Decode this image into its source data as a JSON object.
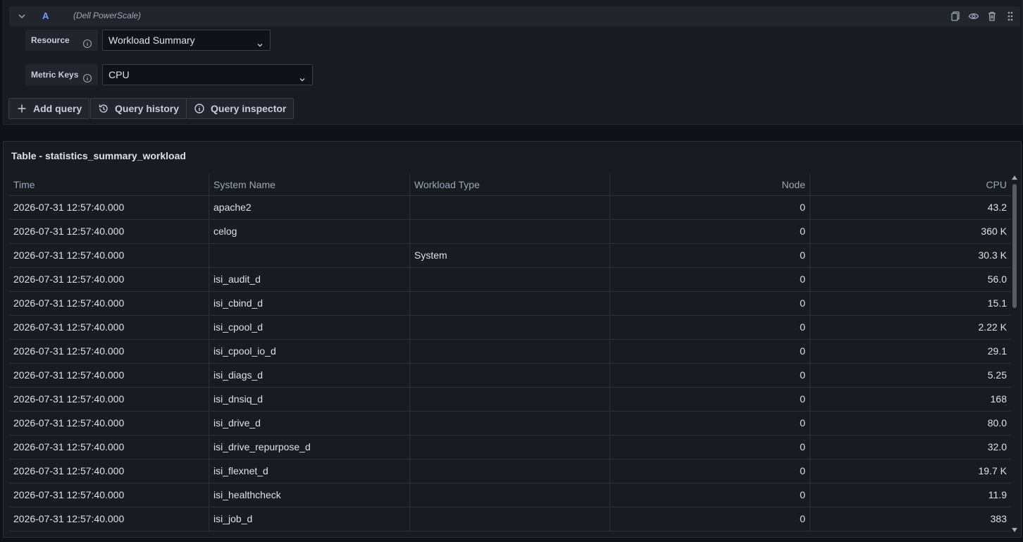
{
  "query": {
    "ref_id": "A",
    "datasource": "(Dell PowerScale)",
    "resource_label": "Resource",
    "resource_value": "Workload Summary",
    "metric_keys_label": "Metric Keys",
    "metric_keys_value": "CPU"
  },
  "buttons": {
    "add_query": "Add query",
    "query_history": "Query history",
    "query_inspector": "Query inspector"
  },
  "panel": {
    "title": "Table - statistics_summary_workload"
  },
  "table": {
    "columns": [
      "Time",
      "System Name",
      "Workload Type",
      "Node",
      "CPU"
    ],
    "rows": [
      [
        "2026-07-31 12:57:40.000",
        "apache2",
        "",
        "0",
        "43.2"
      ],
      [
        "2026-07-31 12:57:40.000",
        "celog",
        "",
        "0",
        "360 K"
      ],
      [
        "2026-07-31 12:57:40.000",
        "",
        "System",
        "0",
        "30.3 K"
      ],
      [
        "2026-07-31 12:57:40.000",
        "isi_audit_d",
        "",
        "0",
        "56.0"
      ],
      [
        "2026-07-31 12:57:40.000",
        "isi_cbind_d",
        "",
        "0",
        "15.1"
      ],
      [
        "2026-07-31 12:57:40.000",
        "isi_cpool_d",
        "",
        "0",
        "2.22 K"
      ],
      [
        "2026-07-31 12:57:40.000",
        "isi_cpool_io_d",
        "",
        "0",
        "29.1"
      ],
      [
        "2026-07-31 12:57:40.000",
        "isi_diags_d",
        "",
        "0",
        "5.25"
      ],
      [
        "2026-07-31 12:57:40.000",
        "isi_dnsiq_d",
        "",
        "0",
        "168"
      ],
      [
        "2026-07-31 12:57:40.000",
        "isi_drive_d",
        "",
        "0",
        "80.0"
      ],
      [
        "2026-07-31 12:57:40.000",
        "isi_drive_repurpose_d",
        "",
        "0",
        "32.0"
      ],
      [
        "2026-07-31 12:57:40.000",
        "isi_flexnet_d",
        "",
        "0",
        "19.7 K"
      ],
      [
        "2026-07-31 12:57:40.000",
        "isi_healthcheck",
        "",
        "0",
        "11.9"
      ],
      [
        "2026-07-31 12:57:40.000",
        "isi_job_d",
        "",
        "0",
        "383"
      ]
    ]
  },
  "icons": {
    "collapse": "chevron-down-icon",
    "duplicate": "copy-icon",
    "hide": "eye-icon",
    "delete": "trash-icon",
    "drag": "drag-handle-icon"
  },
  "colors": {
    "background": "#111217",
    "panel": "#181b1f",
    "accent": "#6e9fff"
  }
}
